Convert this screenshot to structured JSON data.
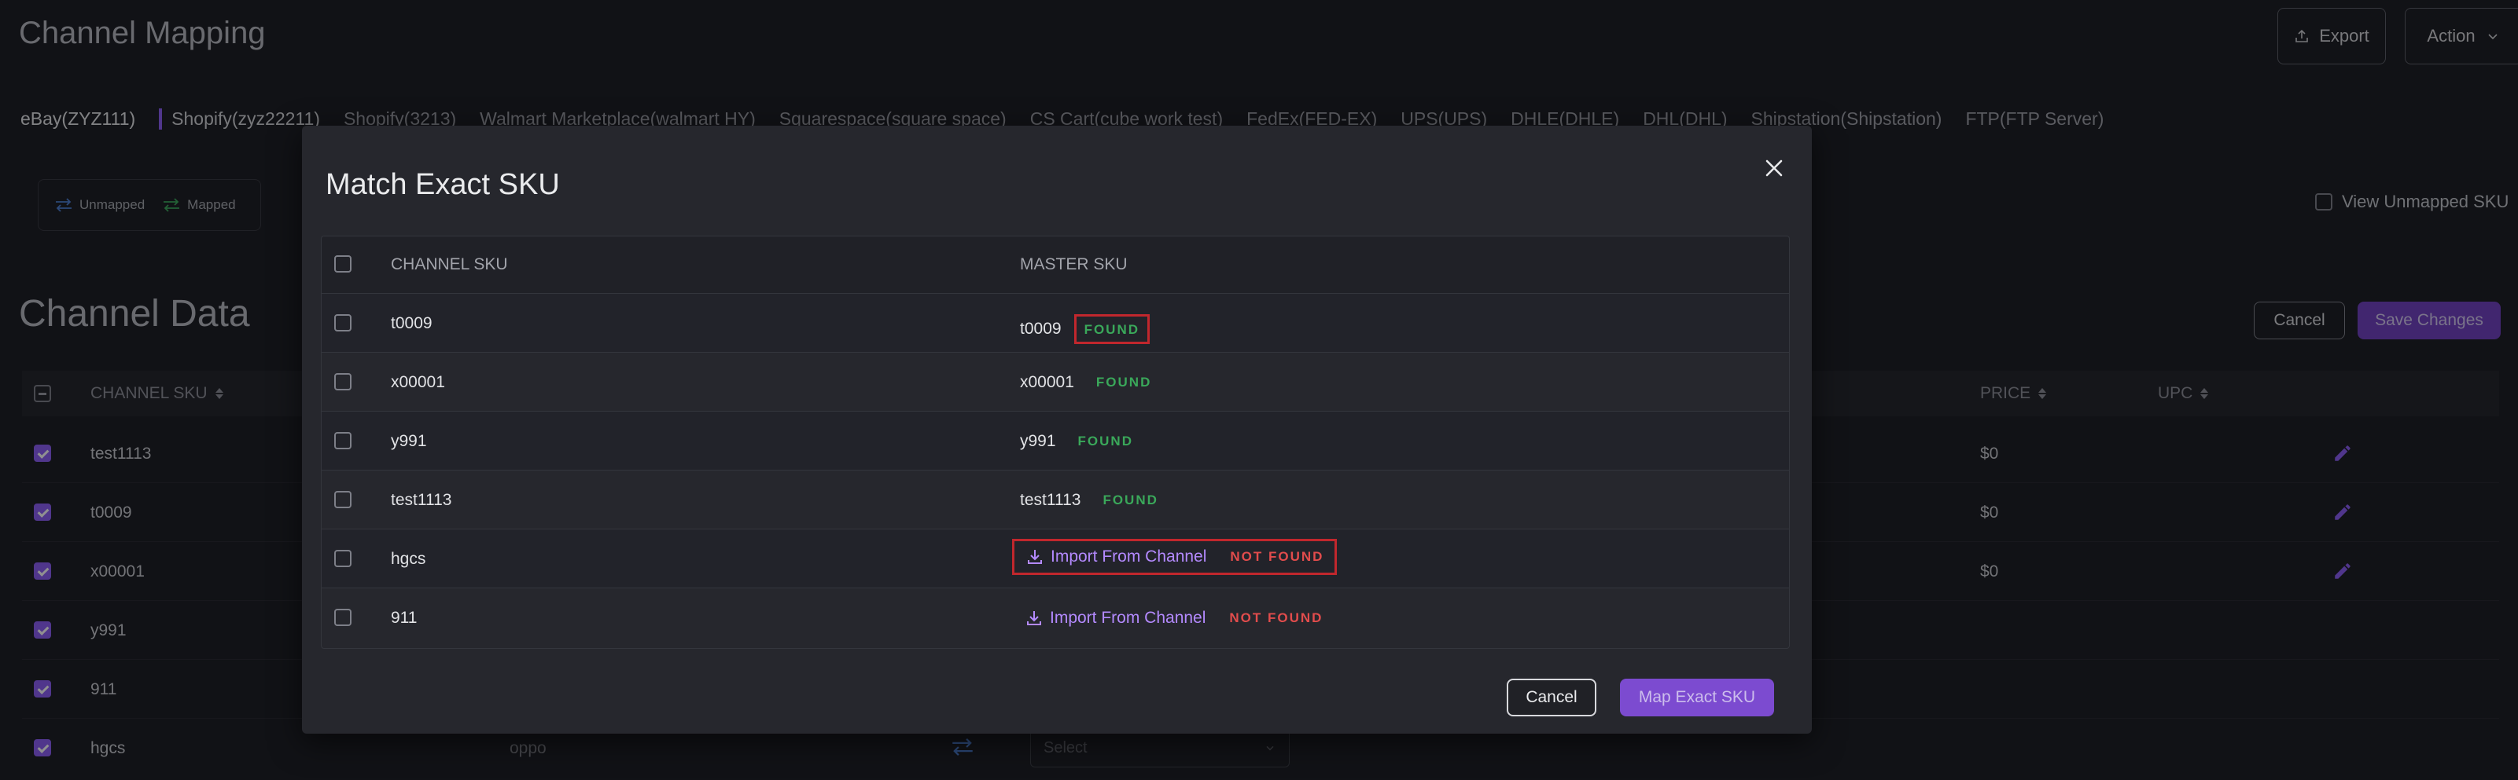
{
  "page": {
    "title": "Channel Mapping",
    "export_label": "Export",
    "action_label": "Action"
  },
  "tabs": [
    "eBay(ZYZ111)",
    "Shopify(zyz22211)",
    "Shopify(3213)",
    "Walmart Marketplace(walmart HY)",
    "Squarespace(square space)",
    "CS Cart(cube work test)",
    "FedEx(FED-EX)",
    "UPS(UPS)",
    "DHLE(DHLE)",
    "DHL(DHL)",
    "Shipstation(Shipstation)",
    "FTP(FTP Server)"
  ],
  "legend": {
    "unmapped": "Unmapped",
    "mapped": "Mapped"
  },
  "view_unmapped_label": "View Unmapped SKU",
  "channel_data": {
    "title": "Channel Data",
    "cancel_label": "Cancel",
    "save_label": "Save Changes",
    "columns": {
      "channel_sku": "CHANNEL SKU",
      "price": "PRICE",
      "upc": "UPC"
    },
    "rows": [
      {
        "sku": "test1113",
        "price": "$0"
      },
      {
        "sku": "t0009",
        "price": "$0"
      },
      {
        "sku": "x00001",
        "price": "$0"
      },
      {
        "sku": "y991",
        "price": ""
      },
      {
        "sku": "911",
        "price": ""
      },
      {
        "sku": "hgcs",
        "price": "",
        "extra": "oppo",
        "select_placeholder": "Select"
      }
    ]
  },
  "modal": {
    "title": "Match Exact SKU",
    "columns": {
      "channel_sku": "CHANNEL SKU",
      "master_sku": "MASTER SKU"
    },
    "rows": [
      {
        "channel_sku": "t0009",
        "master_sku": "t0009",
        "status": "FOUND"
      },
      {
        "channel_sku": "x00001",
        "master_sku": "x00001",
        "status": "FOUND"
      },
      {
        "channel_sku": "y991",
        "master_sku": "y991",
        "status": "FOUND"
      },
      {
        "channel_sku": "test1113",
        "master_sku": "test1113",
        "status": "FOUND"
      },
      {
        "channel_sku": "hgcs",
        "import_label": "Import From Channel",
        "status": "NOT FOUND"
      },
      {
        "channel_sku": "911",
        "import_label": "Import From Channel",
        "status": "NOT FOUND"
      }
    ],
    "cancel_label": "Cancel",
    "map_label": "Map Exact SKU"
  },
  "colors": {
    "accent": "#8b5cf6",
    "found": "#3aa85a",
    "not_found": "#e24c4c",
    "highlight_border": "#c1272d"
  }
}
